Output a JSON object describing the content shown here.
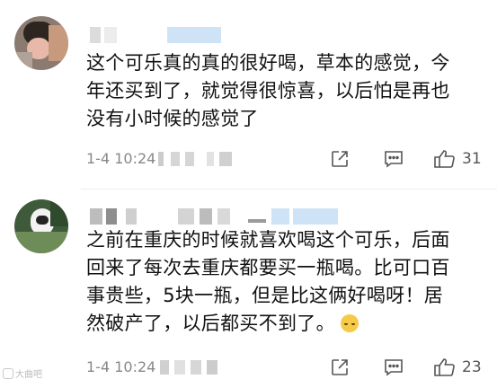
{
  "comments": [
    {
      "lines": [
        "这个可乐真的真的很好喝，草本的感觉，今",
        "年还买到了，就觉得很惊喜，以后怕是再也",
        "没有小时候的感觉了"
      ],
      "time": "1-4 10:24",
      "likes": "31"
    },
    {
      "lines": [
        "之前在重庆的时候就喜欢喝这个可乐，后面",
        "回来了每次去重庆都要买一瓶喝。比可口百",
        "事贵些，5块一瓶，但是比这俩好喝呀！居",
        "然破产了，以后都买不到了。"
      ],
      "time": "1-4 10:24",
      "likes": "23"
    }
  ],
  "watermark": "大曲吧",
  "icons": {
    "share": "share-icon",
    "reply": "comment-icon",
    "like": "thumbs-up-icon",
    "emoji": "crying-face-icon"
  },
  "colors": {
    "text": "#111111",
    "meta": "#888888",
    "icon": "#555555",
    "blur_blue": "#cfe3f7"
  }
}
